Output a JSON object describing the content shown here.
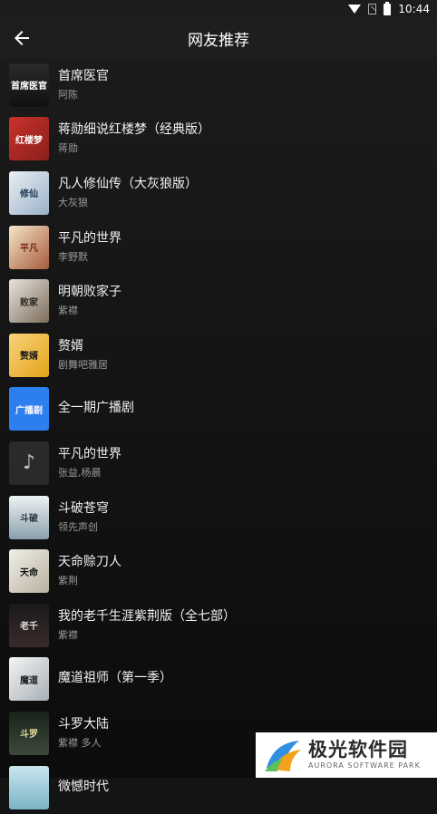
{
  "status": {
    "time": "10:44",
    "icons": [
      "wifi-icon",
      "no-sim-icon",
      "battery-icon"
    ]
  },
  "header": {
    "title": "网友推荐",
    "back_icon": "arrow-left-icon"
  },
  "items": [
    {
      "name": "首席医官",
      "author": "阿陈",
      "cover_text": "首席医官"
    },
    {
      "name": "蒋勋细说红楼梦（经典版）",
      "author": "蒋勋",
      "cover_text": "红楼梦"
    },
    {
      "name": "凡人修仙传（大灰狼版）",
      "author": "大灰狼",
      "cover_text": "修仙"
    },
    {
      "name": "平凡的世界",
      "author": "李野默",
      "cover_text": "平凡"
    },
    {
      "name": "明朝败家子",
      "author": "紫襟",
      "cover_text": "败家"
    },
    {
      "name": "赘婿",
      "author": "剧舞吧雅居",
      "cover_text": "赘婿"
    },
    {
      "name": "全一期广播剧",
      "author": "",
      "cover_text": "广播剧"
    },
    {
      "name": "平凡的世界",
      "author": "张益,杨晨",
      "cover_text": "♪"
    },
    {
      "name": "斗破苍穹",
      "author": "领先声创",
      "cover_text": "斗破"
    },
    {
      "name": "天命赊刀人",
      "author": "紫荆",
      "cover_text": "天命"
    },
    {
      "name": "我的老千生涯紫荆版（全七部）",
      "author": "紫襟",
      "cover_text": "老千"
    },
    {
      "name": "魔道祖师（第一季）",
      "author": "",
      "cover_text": "魔道"
    },
    {
      "name": "斗罗大陆",
      "author": "紫襟 多人",
      "cover_text": "斗罗"
    },
    {
      "name": "微憾时代",
      "author": "",
      "cover_text": ""
    }
  ],
  "watermark": {
    "cn": "极光软件园",
    "en": "AURORA SOFTWARE PARK"
  },
  "colors": {
    "background": "#141414",
    "header": "#1e1e1e",
    "text_primary": "#f2f2f2",
    "text_secondary": "#9a9a9a"
  }
}
